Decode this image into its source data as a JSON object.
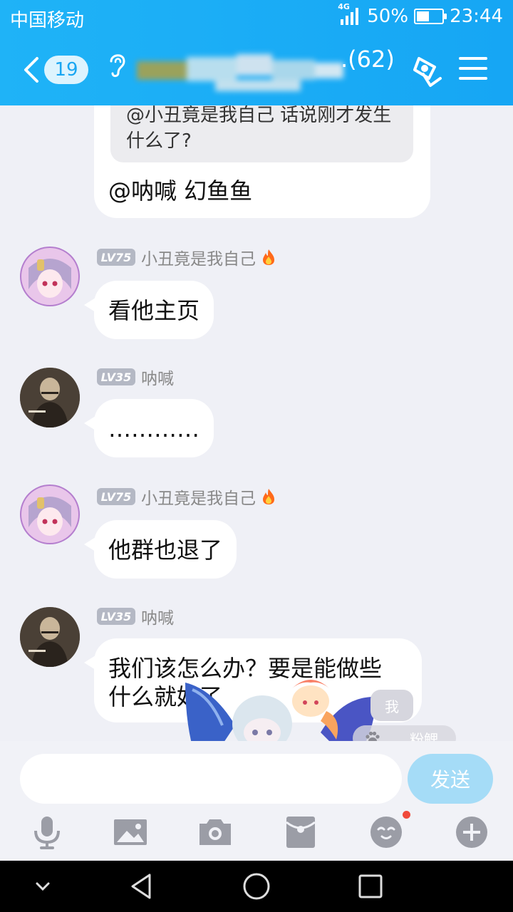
{
  "status_bar": {
    "carrier": "中国移动",
    "network": "4G",
    "battery_percent": "50%",
    "battery_level": 0.5,
    "time": "23:44"
  },
  "header": {
    "unread_count": "19",
    "member_count": ".(62)"
  },
  "messages": [
    {
      "quote": "@小丑竟是我自己 话说刚才发生什么了?",
      "text": "@呐喊 幻鱼鱼"
    },
    {
      "level": "LV75",
      "sender": "小丑竟是我自己",
      "text": "看他主页"
    },
    {
      "level": "LV35",
      "sender": "呐喊",
      "text": "…………"
    },
    {
      "level": "LV75",
      "sender": "小丑竟是我自己",
      "text": "他群也退了"
    },
    {
      "level": "LV35",
      "sender": "呐喊",
      "text_line1": "我们该怎么办？要是能做些",
      "text_line2": "什么就好了"
    }
  ],
  "sticker": {
    "me_label": "我",
    "pet_label": "粉鲤"
  },
  "input": {
    "send_label": "发送"
  },
  "icons": {
    "voice": "microphone-icon",
    "image": "image-icon",
    "camera": "camera-icon",
    "red_packet": "red-packet-icon",
    "emoji": "emoji-icon",
    "more": "plus-icon"
  },
  "colors": {
    "header": "#1fb3f7",
    "send_button": "#a5dcf7",
    "level_badge": "#b4b8c4",
    "notification_dot": "#f04a3b"
  }
}
